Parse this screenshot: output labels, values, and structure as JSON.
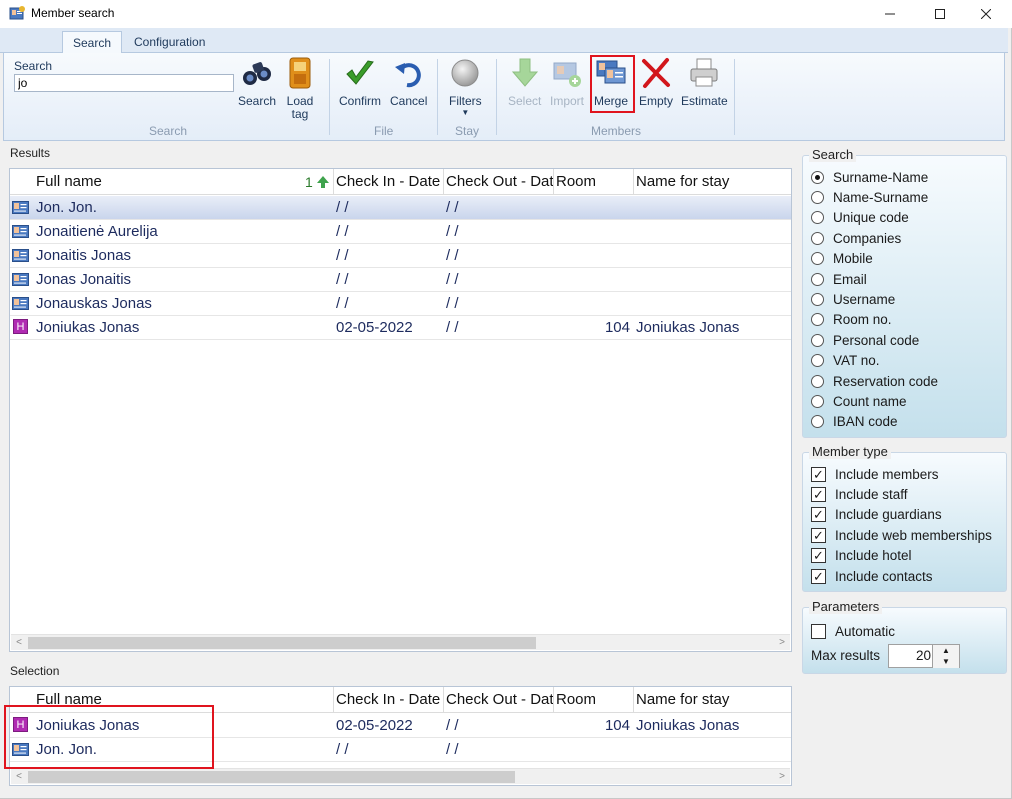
{
  "window": {
    "title": "Member search"
  },
  "ribbon": {
    "tabs": [
      "Search",
      "Configuration"
    ],
    "search_label": "Search",
    "search_value": "jo",
    "buttons": {
      "search": "Search",
      "load_tag": "Load tag",
      "confirm": "Confirm",
      "cancel": "Cancel",
      "filters": "Filters",
      "select": "Select",
      "import": "Import",
      "merge": "Merge",
      "empty": "Empty",
      "estimate": "Estimate"
    },
    "groups": {
      "search": "Search",
      "file": "File",
      "stay": "Stay",
      "members": "Members"
    }
  },
  "results": {
    "label": "Results",
    "sort_indicator": "1",
    "columns": [
      "Full name",
      "Check In - Date",
      "Check Out - Date",
      "Room",
      "Name for stay"
    ],
    "rows": [
      {
        "type": "member",
        "name": "Jon. Jon.",
        "check_in": " /  /",
        "check_out": " /  /",
        "room": "",
        "stay_name": "",
        "selected": true
      },
      {
        "type": "member",
        "name": "Jonaitienė Aurelija",
        "check_in": " /  /",
        "check_out": " /  /",
        "room": "",
        "stay_name": ""
      },
      {
        "type": "member",
        "name": "Jonaitis Jonas",
        "check_in": " /  /",
        "check_out": " /  /",
        "room": "",
        "stay_name": ""
      },
      {
        "type": "member",
        "name": "Jonas Jonaitis",
        "check_in": " /  /",
        "check_out": " /  /",
        "room": "",
        "stay_name": ""
      },
      {
        "type": "member",
        "name": "Jonauskas Jonas",
        "check_in": " /  /",
        "check_out": " /  /",
        "room": "",
        "stay_name": ""
      },
      {
        "type": "hotel",
        "name": "Joniukas Jonas",
        "check_in": "02-05-2022",
        "check_out": " /  /",
        "room": "104",
        "stay_name": "Joniukas Jonas"
      }
    ]
  },
  "selection": {
    "label": "Selection",
    "columns": [
      "Full name",
      "Check In - Date",
      "Check Out - Date",
      "Room",
      "Name for stay"
    ],
    "rows": [
      {
        "type": "hotel",
        "name": "Joniukas Jonas",
        "check_in": "02-05-2022",
        "check_out": " /  /",
        "room": "104",
        "stay_name": "Joniukas Jonas"
      },
      {
        "type": "member",
        "name": "Jon. Jon.",
        "check_in": " /  /",
        "check_out": " /  /",
        "room": "",
        "stay_name": ""
      }
    ]
  },
  "search_options": {
    "title": "Search",
    "options": [
      "Surname-Name",
      "Name-Surname",
      "Unique code",
      "Companies",
      "Mobile",
      "Email",
      "Username",
      "Room no.",
      "Personal code",
      "VAT no.",
      "Reservation code",
      "Count name",
      "IBAN code"
    ],
    "selected": "Surname-Name"
  },
  "member_type": {
    "title": "Member type",
    "options": [
      {
        "label": "Include members",
        "checked": true
      },
      {
        "label": "Include staff",
        "checked": true
      },
      {
        "label": "Include guardians",
        "checked": true
      },
      {
        "label": "Include web memberships",
        "checked": true
      },
      {
        "label": "Include hotel",
        "checked": true
      },
      {
        "label": "Include contacts",
        "checked": true
      }
    ]
  },
  "parameters": {
    "title": "Parameters",
    "automatic_label": "Automatic",
    "automatic_checked": false,
    "max_results_label": "Max results",
    "max_results": "20"
  },
  "colors": {
    "highlight_red": "#e0141e",
    "row_text": "#1d2b5e",
    "hotel_icon": "#b02bb2"
  }
}
